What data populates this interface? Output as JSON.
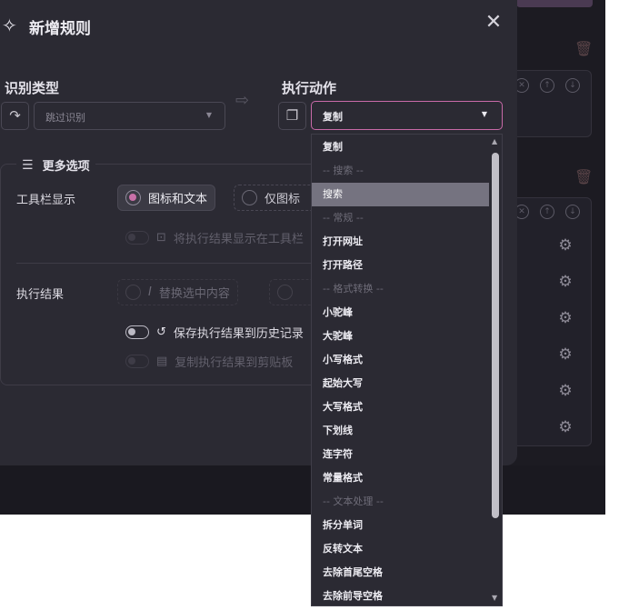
{
  "dialog": {
    "title": "新增规则",
    "recognize_label": "识别类型",
    "recognize_value": "跳过识别",
    "action_label": "执行动作",
    "action_value": "复制"
  },
  "more_options": {
    "legend": "更多选项",
    "toolbar_label": "工具栏显示",
    "toolbar_opt_icon_text": "图标和文本",
    "toolbar_opt_icon_only": "仅图标",
    "show_result_in_toolbar": "将执行结果显示在工具栏",
    "result_label": "执行结果",
    "replace_selection": "替换选中内容",
    "save_history": "保存执行结果到历史记录",
    "copy_clipboard": "复制执行结果到剪贴板"
  },
  "dropdown": {
    "items": [
      {
        "label": "复制",
        "kind": "opt"
      },
      {
        "label": "-- 搜索 --",
        "kind": "group"
      },
      {
        "label": "搜索",
        "kind": "active"
      },
      {
        "label": "-- 常规 --",
        "kind": "group"
      },
      {
        "label": "打开网址",
        "kind": "opt"
      },
      {
        "label": "打开路径",
        "kind": "opt"
      },
      {
        "label": "-- 格式转换 --",
        "kind": "group"
      },
      {
        "label": "小驼峰",
        "kind": "opt"
      },
      {
        "label": "大驼峰",
        "kind": "opt"
      },
      {
        "label": "小写格式",
        "kind": "opt"
      },
      {
        "label": "起始大写",
        "kind": "opt"
      },
      {
        "label": "大写格式",
        "kind": "opt"
      },
      {
        "label": "下划线",
        "kind": "opt"
      },
      {
        "label": "连字符",
        "kind": "opt"
      },
      {
        "label": "常量格式",
        "kind": "opt"
      },
      {
        "label": "-- 文本处理 --",
        "kind": "group"
      },
      {
        "label": "拆分单词",
        "kind": "opt"
      },
      {
        "label": "反转文本",
        "kind": "opt"
      },
      {
        "label": "去除首尾空格",
        "kind": "opt"
      },
      {
        "label": "去除前导空格",
        "kind": "opt"
      }
    ]
  },
  "colors": {
    "accent": "#c86aa8",
    "dialog_bg": "#2b2a33",
    "window_bg": "#1c1b22",
    "dropdown_active": "#757380"
  }
}
